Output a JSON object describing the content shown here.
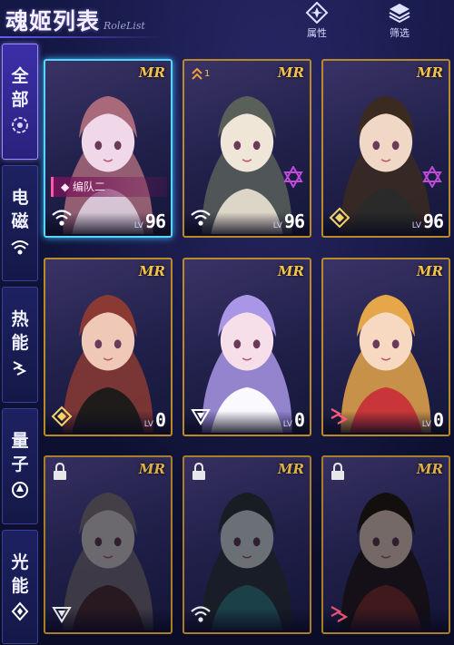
{
  "header": {
    "title": "魂姬列表",
    "subtitle": "RoleList",
    "attribute_label": "属性",
    "filter_label": "筛选",
    "attribute_icon": "diamond-star-icon",
    "filter_icon": "layers-icon"
  },
  "sidebar": {
    "tabs": [
      {
        "chars": [
          "全",
          "部"
        ],
        "icon": "all-icon",
        "active": true
      },
      {
        "chars": [
          "电",
          "磁"
        ],
        "icon": "wifi-icon",
        "active": false
      },
      {
        "chars": [
          "热",
          "能"
        ],
        "icon": "heat-icon",
        "active": false
      },
      {
        "chars": [
          "量",
          "子"
        ],
        "icon": "quantum-icon",
        "active": false
      },
      {
        "chars": [
          "光",
          "能"
        ],
        "icon": "light-icon",
        "active": false
      }
    ]
  },
  "cards": [
    {
      "rarity": "MR",
      "level_label": "LV",
      "level": "96",
      "team": "编队二",
      "element": "wifi-icon",
      "star": false,
      "locked": false,
      "selected": true,
      "rank": "",
      "palette": [
        "#f0d8e8",
        "#a86a7a",
        "#d9c9d9"
      ]
    },
    {
      "rarity": "MR",
      "level_label": "LV",
      "level": "96",
      "team": "",
      "element": "wifi-icon",
      "star": true,
      "locked": false,
      "selected": false,
      "rank": "1",
      "palette": [
        "#efe6d8",
        "#59605a",
        "#e5dccd"
      ]
    },
    {
      "rarity": "MR",
      "level_label": "LV",
      "level": "96",
      "team": "",
      "element": "quantum-icon",
      "star": true,
      "locked": false,
      "selected": false,
      "rank": "",
      "palette": [
        "#f1d8c6",
        "#3a2a20",
        "#2a2a2a"
      ]
    },
    {
      "rarity": "MR",
      "level_label": "LV",
      "level": "0",
      "team": "",
      "element": "quantum-icon",
      "star": false,
      "locked": false,
      "selected": false,
      "rank": "",
      "palette": [
        "#f0c8b8",
        "#8b3a33",
        "#1a1a1a"
      ]
    },
    {
      "rarity": "MR",
      "level_label": "LV",
      "level": "0",
      "team": "",
      "element": "light-icon",
      "star": false,
      "locked": false,
      "selected": false,
      "rank": "",
      "palette": [
        "#f6dfe8",
        "#a996e6",
        "#ffffff"
      ]
    },
    {
      "rarity": "MR",
      "level_label": "LV",
      "level": "0",
      "team": "",
      "element": "heat-icon",
      "star": false,
      "locked": false,
      "selected": false,
      "rank": "",
      "palette": [
        "#f6d9c0",
        "#e6a64a",
        "#c8323a"
      ]
    },
    {
      "rarity": "MR",
      "level_label": "",
      "level": "",
      "team": "",
      "element": "light-icon",
      "star": false,
      "locked": true,
      "selected": false,
      "rank": "",
      "palette": [
        "#d8d0d8",
        "#8a7a88",
        "#5a2a3a"
      ]
    },
    {
      "rarity": "MR",
      "level_label": "",
      "level": "",
      "team": "",
      "element": "wifi-icon",
      "star": false,
      "locked": true,
      "selected": false,
      "rank": "",
      "palette": [
        "#d0e0e8",
        "#2a3a40",
        "#1a8a9a"
      ]
    },
    {
      "rarity": "MR",
      "level_label": "",
      "level": "",
      "team": "",
      "element": "heat-icon",
      "star": false,
      "locked": true,
      "selected": false,
      "rank": "",
      "palette": [
        "#f0d0c0",
        "#2a1a14",
        "#a02a2a"
      ]
    }
  ]
}
